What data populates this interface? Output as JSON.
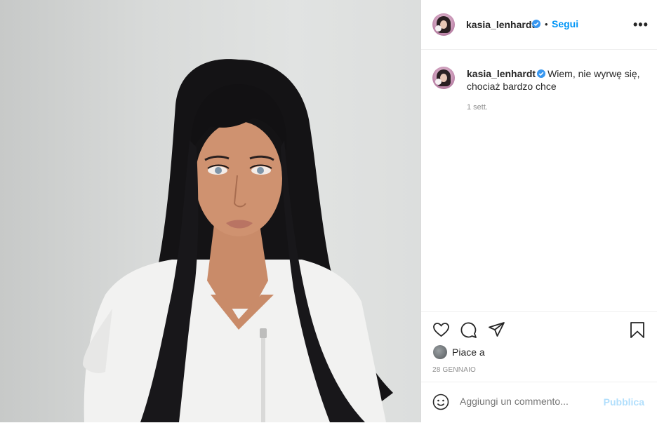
{
  "header": {
    "username": "kasia_lenhardt",
    "separator": "•",
    "follow_label": "Segui",
    "more_label": "•••"
  },
  "caption": {
    "username": "kasia_lenhardt",
    "text": "Wiem, nie wyrwę się, chociaż bardzo chce",
    "time_ago": "1 sett."
  },
  "actions": {
    "likes_label": "Piace a",
    "date": "28 GENNAIO"
  },
  "comment": {
    "placeholder": "Aggiungi un commento...",
    "publish_label": "Pubblica"
  },
  "colors": {
    "accent": "#0095f6",
    "verified": "#3897f0",
    "publish_disabled": "#b2dffc",
    "text": "#262626",
    "muted": "#8e8e8e"
  },
  "icons": [
    "verified-badge-icon",
    "more-options-icon",
    "heart-icon",
    "comment-icon",
    "share-icon",
    "bookmark-icon",
    "emoji-icon"
  ]
}
